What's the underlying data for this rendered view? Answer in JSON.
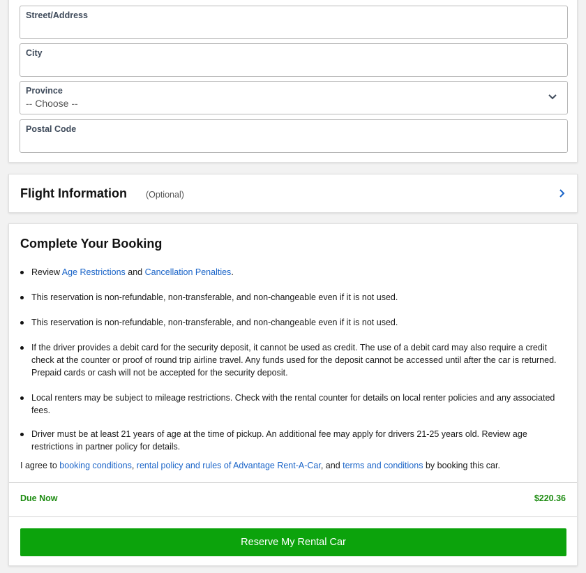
{
  "address": {
    "street_label": "Street/Address",
    "city_label": "City",
    "province_label": "Province",
    "province_value": "-- Choose --",
    "postal_label": "Postal Code"
  },
  "flight": {
    "title": "Flight Information",
    "optional": "(Optional)"
  },
  "booking": {
    "title": "Complete Your Booking",
    "bullet1_pre": "Review ",
    "bullet1_link1": "Age Restrictions",
    "bullet1_mid": " and ",
    "bullet1_link2": "Cancellation Penalties",
    "bullet1_post": ".",
    "bullet2": "This reservation is non-refundable, non-transferable, and non-changeable even if it is not used.",
    "bullet3": "This reservation is non-refundable, non-transferable, and non-changeable even if it is not used.",
    "bullet4": "If the driver provides a debit card for the security deposit, it cannot be used as credit. The use of a debit card may also require a credit check at the counter or proof of round trip airline travel. Any funds used for the deposit cannot be accessed until after the car is returned. Prepaid cards or cash will not be accepted for the security deposit.",
    "bullet5": "Local renters may be subject to mileage restrictions. Check with the rental counter for details on local renter policies and any associated fees.",
    "bullet6": "Driver must be at least 21 years of age at the time of pickup. An additional fee may apply for drivers 21-25 years old. Review age restrictions in partner policy for details.",
    "agree_pre": "I agree to ",
    "agree_link1": "booking conditions",
    "agree_sep1": ", ",
    "agree_link2": "rental policy and rules of Advantage Rent-A-Car",
    "agree_sep2": ", and ",
    "agree_link3": "terms and conditions",
    "agree_post": " by booking this car.",
    "due_label": "Due Now",
    "due_amount": "$220.36",
    "reserve_label": "Reserve My Rental Car"
  },
  "icons": {
    "province_dropdown": "chevron-down-icon",
    "flight_expand": "chevron-right-icon"
  },
  "colors": {
    "link": "#1a64c8",
    "due": "#1e8c12",
    "button": "#0ca30c"
  }
}
